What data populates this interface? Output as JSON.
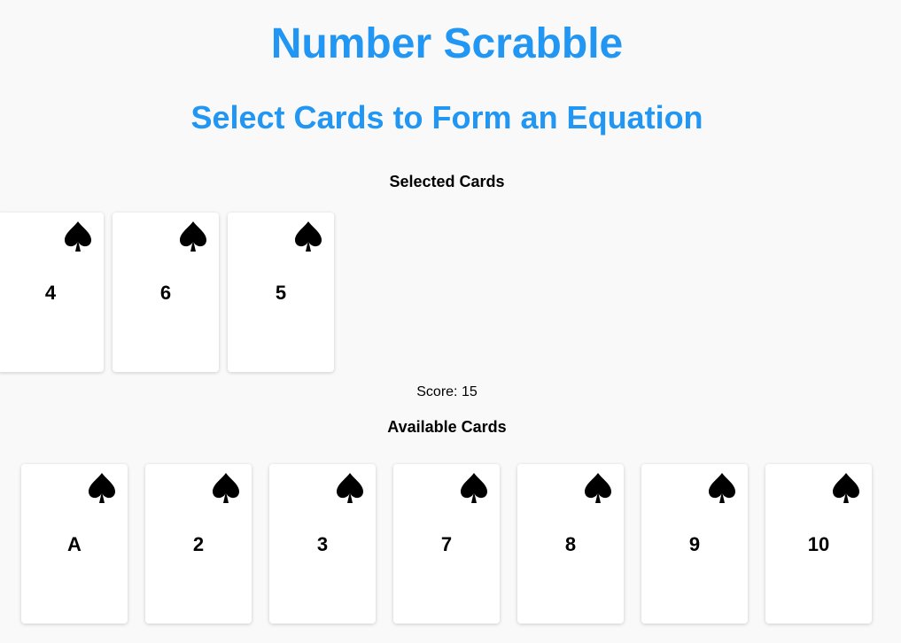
{
  "title": "Number Scrabble",
  "subtitle": "Select Cards to Form an Equation",
  "selected": {
    "heading": "Selected Cards",
    "cards": [
      {
        "value": "4",
        "suit": "spade-icon"
      },
      {
        "value": "6",
        "suit": "spade-icon"
      },
      {
        "value": "5",
        "suit": "spade-icon"
      }
    ]
  },
  "score": {
    "text": "Score: 15"
  },
  "available": {
    "heading": "Available Cards",
    "cards": [
      {
        "value": "A",
        "suit": "spade-icon"
      },
      {
        "value": "2",
        "suit": "spade-icon"
      },
      {
        "value": "3",
        "suit": "spade-icon"
      },
      {
        "value": "7",
        "suit": "spade-icon"
      },
      {
        "value": "8",
        "suit": "spade-icon"
      },
      {
        "value": "9",
        "suit": "spade-icon"
      },
      {
        "value": "10",
        "suit": "spade-icon"
      }
    ]
  },
  "colors": {
    "accent": "#2196f3",
    "background": "#f9f9f9",
    "card": "#ffffff",
    "suit": "#000000"
  }
}
